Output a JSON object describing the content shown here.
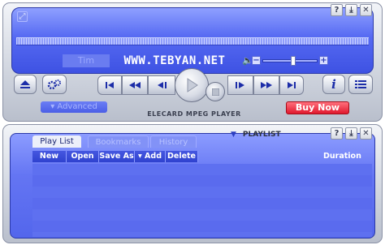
{
  "player": {
    "time_display": "Tim",
    "title_text": "WWW.TEBYAN.NET",
    "seek_progress": 0.0,
    "volume_level": 0.55,
    "window_buttons": {
      "help": "?",
      "minimize": "⤓",
      "close": "✕"
    },
    "advanced_label": "▾ Advanced",
    "brand_label": "ELECARD  MPEG  PLAYER",
    "buy_now_label": "Buy Now",
    "info_label": "i"
  },
  "playlist": {
    "title": "PLAYLIST",
    "tabs": [
      {
        "label": "Play List",
        "active": true
      },
      {
        "label": "Bookmarks",
        "active": false
      },
      {
        "label": "History",
        "active": false
      }
    ],
    "toolbar": {
      "new": "New",
      "open": "Open",
      "save_as": "Save As",
      "add": "▾ Add",
      "delete": "Delete"
    },
    "columns": {
      "duration": "Duration"
    },
    "items": []
  },
  "colors": {
    "display_blue": "#5569f2",
    "accent_blue": "#1c2da8",
    "buy_red": "#e0192e"
  }
}
